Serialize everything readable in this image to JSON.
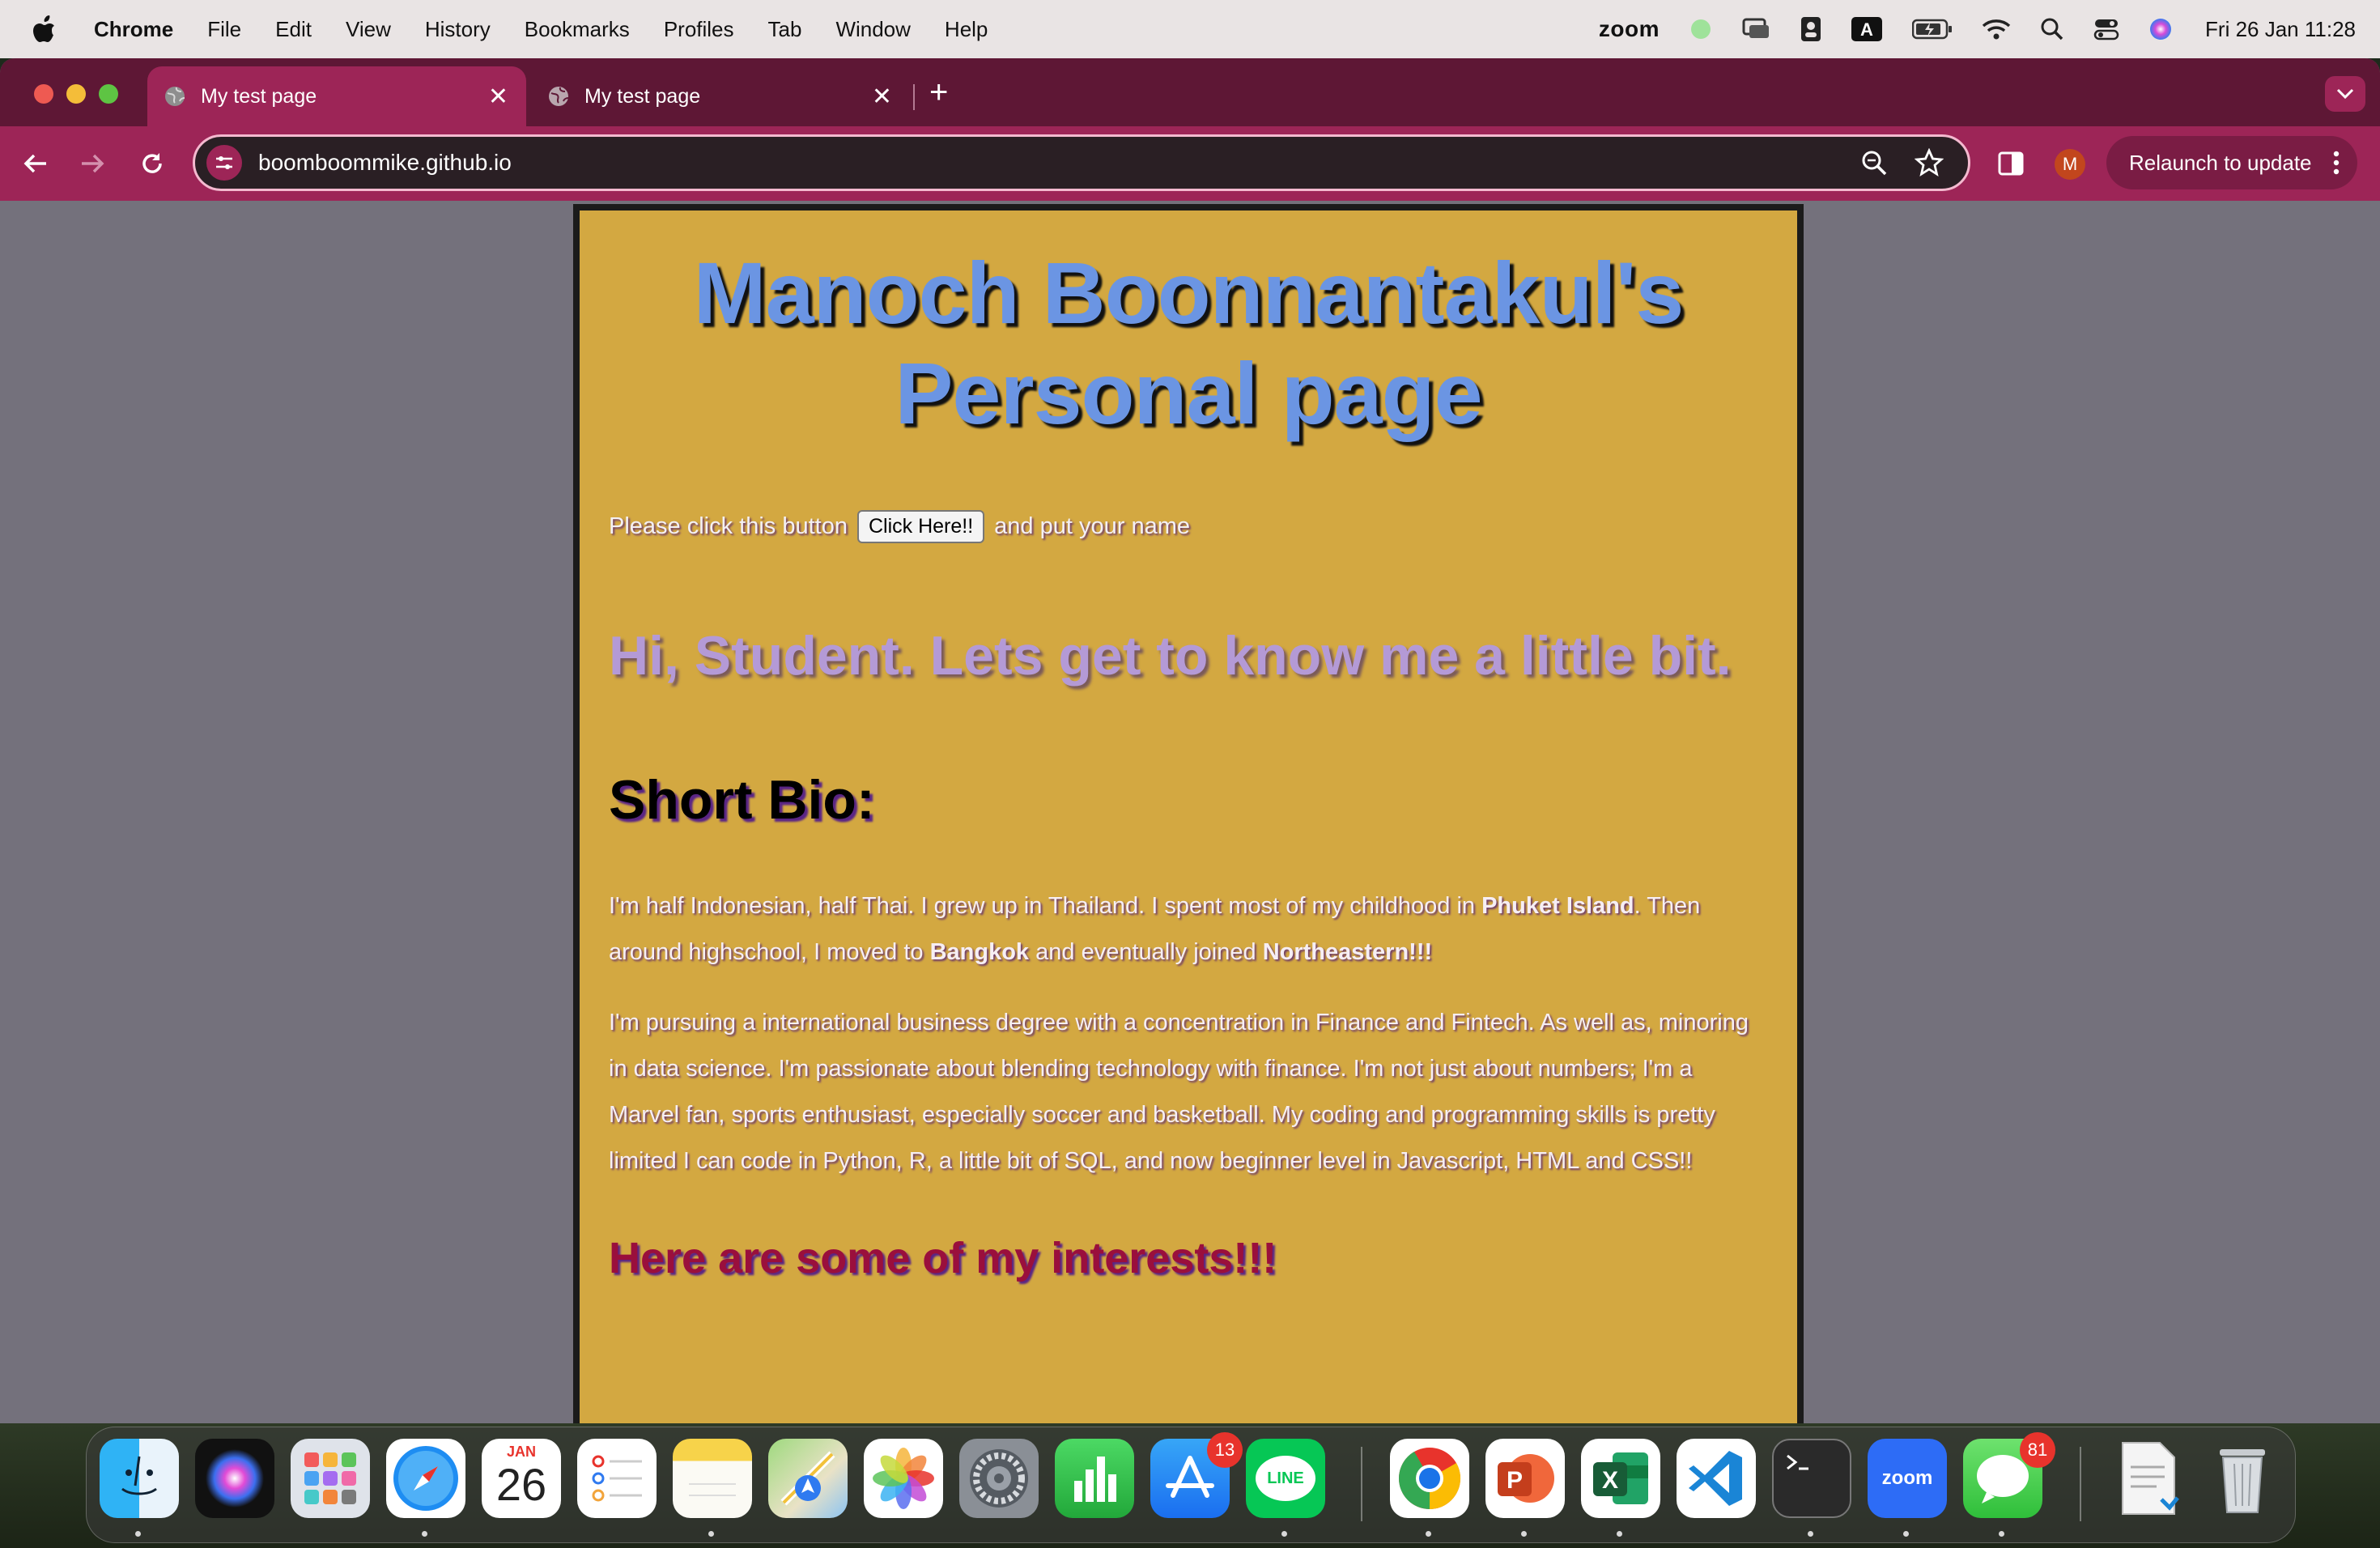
{
  "menubar": {
    "app_name": "Chrome",
    "menus": [
      "File",
      "Edit",
      "View",
      "History",
      "Bookmarks",
      "Profiles",
      "Tab",
      "Window",
      "Help"
    ],
    "status_zoom": "zoom",
    "status_input": "A",
    "clock": "Fri 26 Jan  11:28"
  },
  "browser": {
    "tabs": [
      {
        "title": "My test page",
        "active": true
      },
      {
        "title": "My test page",
        "active": false
      }
    ],
    "url": "boomboommike.github.io",
    "profile_initial": "M",
    "relaunch_label": "Relaunch to update"
  },
  "page": {
    "title": "Manoch Boonnantakul's Personal page",
    "intro_before": "Please click this button",
    "button_label": "Click Here!!",
    "intro_after": "and put your name",
    "greeting": "Hi, Student. Lets get to know me a little bit.",
    "bio_heading": "Short Bio:",
    "bio_p1": {
      "t1": "I'm half Indonesian, half Thai. I grew up in Thailand. I spent most of my childhood in ",
      "b1": "Phuket Island",
      "t2": ". Then around highschool, I moved to ",
      "b2": "Bangkok",
      "t3": " and eventually joined ",
      "b3": "Northeastern!!!"
    },
    "bio_p2": "I'm pursuing a international business degree with a concentration in Finance and Fintech. As well as, minoring in data science. I'm passionate about blending technology with finance. I'm not just about numbers; I'm a Marvel fan, sports enthusiast, especially soccer and basketball. My coding and programming skills is pretty limited I can code in Python, R, a little bit of SQL, and now beginner level in Javascript, HTML and CSS!!",
    "interests_heading": "Here are some of my interests!!!"
  },
  "dock": {
    "calendar_month": "JAN",
    "calendar_day": "26",
    "appstore_badge": "13",
    "messages_badge": "81",
    "line_label": "LINE",
    "zoom_label": "zoom",
    "powerpoint_letter": "P",
    "excel_letter": "X",
    "apps": [
      "finder-icon",
      "siri-icon",
      "launchpad-icon",
      "safari-icon",
      "calendar-icon",
      "reminders-icon",
      "notes-icon",
      "maps-icon",
      "photos-icon",
      "system-settings-icon",
      "numbers-icon",
      "app-store-icon",
      "line-icon",
      "chrome-icon",
      "powerpoint-icon",
      "excel-icon",
      "vscode-icon",
      "terminal-icon",
      "zoom-icon",
      "messages-icon",
      "document-icon",
      "trash-icon"
    ]
  },
  "colors": {
    "tab_strip": "#5e1735",
    "toolbar": "#9d2557",
    "page_background": "#d3a841",
    "title_color": "#6b95e3",
    "greeting_color": "#b49ad6",
    "interests_color": "#9a0f3c"
  }
}
